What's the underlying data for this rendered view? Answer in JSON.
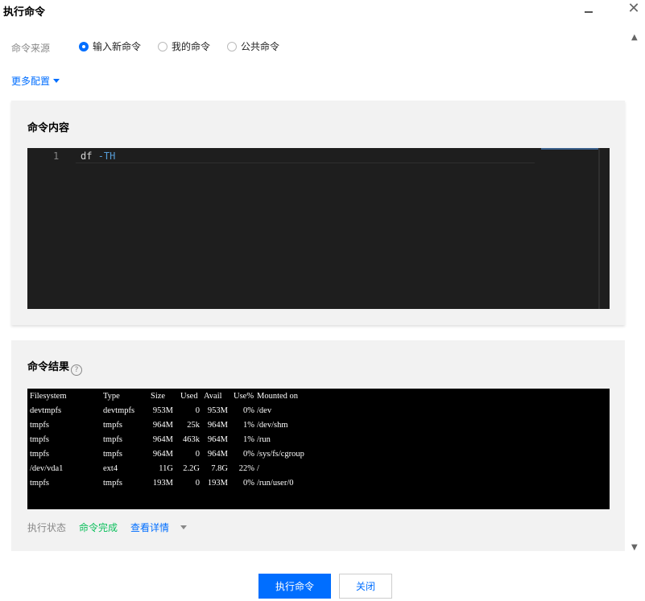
{
  "window": {
    "title": "执行命令",
    "minimize_icon": "minimize-icon",
    "close_icon": "close-icon"
  },
  "source": {
    "label": "命令来源",
    "options": [
      {
        "label": "输入新命令",
        "selected": true
      },
      {
        "label": "我的命令",
        "selected": false
      },
      {
        "label": "公共命令",
        "selected": false
      }
    ]
  },
  "more_config": {
    "label": "更多配置",
    "icon": "caret-down-icon"
  },
  "command": {
    "title": "命令内容",
    "line_number": "1",
    "code_cmd": "df",
    "code_flag": "-TH"
  },
  "result": {
    "title": "命令结果",
    "help_icon": "question-circle-icon",
    "headers": [
      "Filesystem",
      "Type",
      "Size",
      "Used",
      "Avail",
      "Use%",
      "Mounted on"
    ],
    "rows": [
      [
        "devtmpfs",
        "devtmpfs",
        "953M",
        "0",
        "953M",
        "0%",
        "/dev"
      ],
      [
        "tmpfs",
        "tmpfs",
        "964M",
        "25k",
        "964M",
        "1%",
        "/dev/shm"
      ],
      [
        "tmpfs",
        "tmpfs",
        "964M",
        "463k",
        "964M",
        "1%",
        "/run"
      ],
      [
        "tmpfs",
        "tmpfs",
        "964M",
        "0",
        "964M",
        "0%",
        "/sys/fs/cgroup"
      ],
      [
        "/dev/vda1",
        "ext4",
        "11G",
        "2.2G",
        "7.8G",
        "22%",
        "/"
      ],
      [
        "tmpfs",
        "tmpfs",
        "193M",
        "0",
        "193M",
        "0%",
        "/run/user/0"
      ]
    ]
  },
  "status": {
    "label": "执行状态",
    "value": "命令完成",
    "value_color": "#0abf5b",
    "details_link": "查看详情"
  },
  "footer": {
    "execute_label": "执行命令",
    "close_label": "关闭",
    "primary_color": "#006eff"
  }
}
